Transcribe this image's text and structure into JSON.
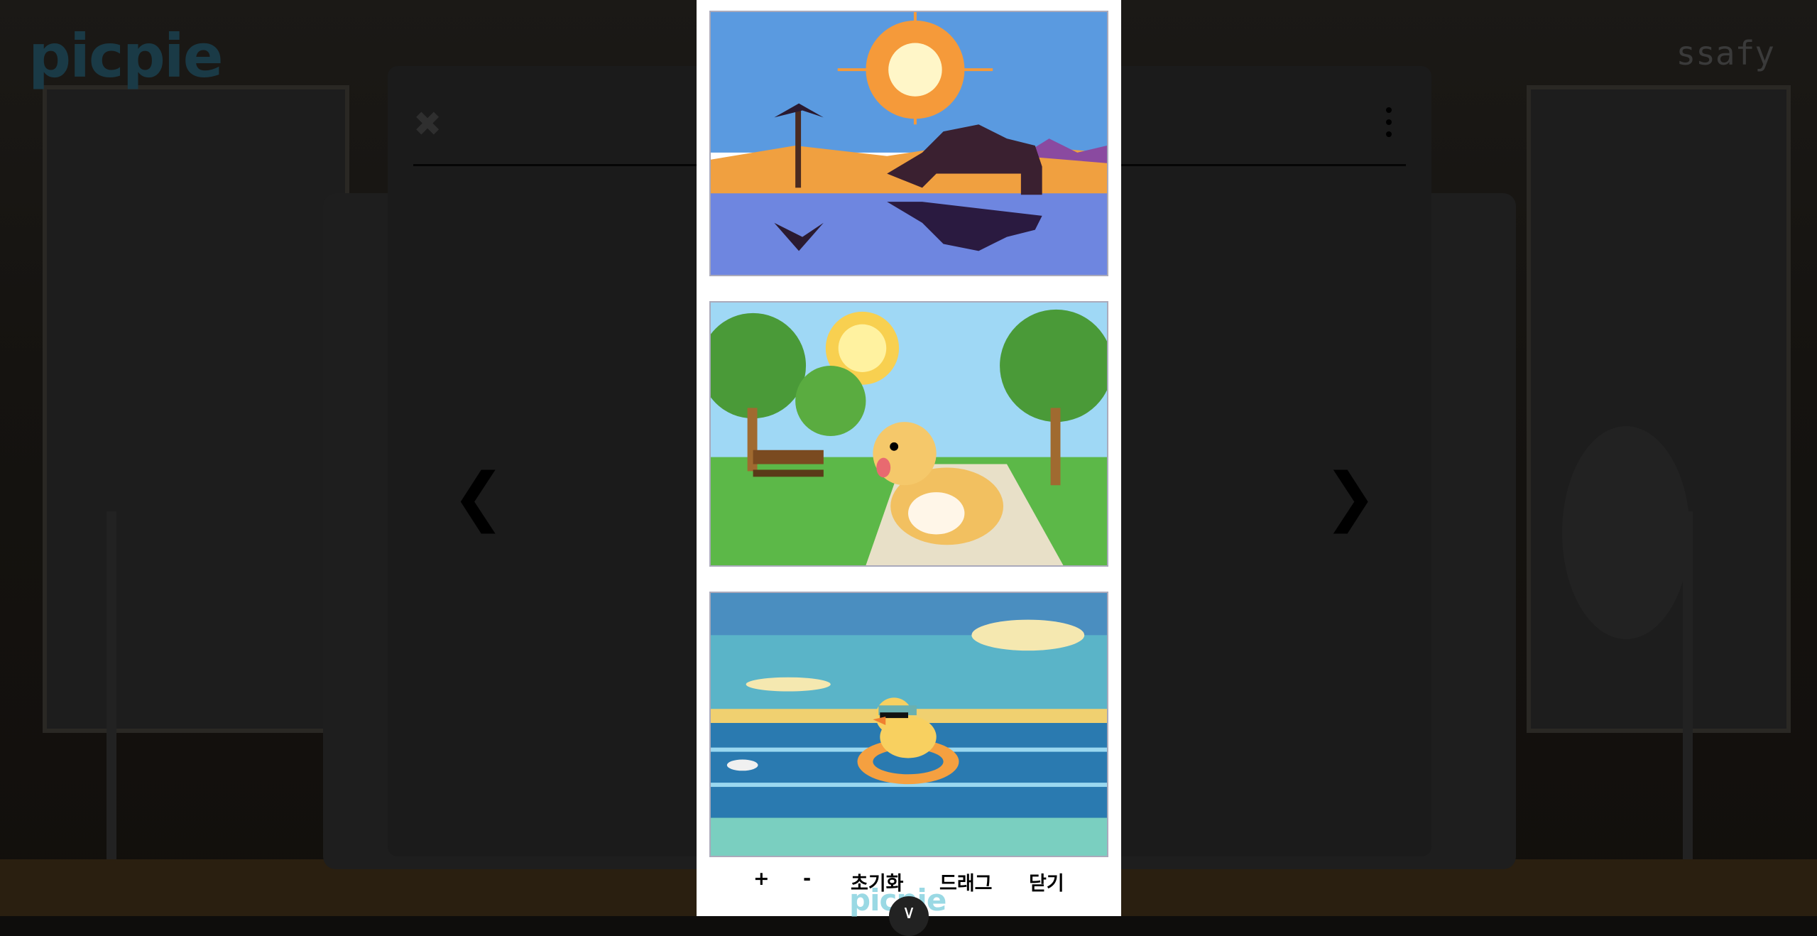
{
  "background": {
    "logo_text": "picpie",
    "brand_text": "ssafy"
  },
  "modal": {
    "close_icon": "close-icon",
    "menu_icon": "kebab-menu-icon",
    "prev_icon": "chevron-left-icon",
    "next_icon": "chevron-right-icon",
    "prev_glyph": "❮",
    "next_glyph": "❯",
    "close_glyph": "✖"
  },
  "photos": [
    {
      "subject": "pixel-art desert oasis with camel and palm tree"
    },
    {
      "subject": "pixel-art golden retriever in a park"
    },
    {
      "subject": "pixel-art duck with sunglasses on a swim ring at sea"
    }
  ],
  "toolbar": {
    "zoom_in": "+",
    "zoom_out": "-",
    "reset": "초기화",
    "drag": "드래그",
    "close": "닫기"
  },
  "footer": {
    "logo": "picpie",
    "scroll_glyph": "∨"
  },
  "colors": {
    "strip_bg": "#ffffff",
    "overlay": "#0e0d0c",
    "logo_accent": "#9ad9e4"
  }
}
